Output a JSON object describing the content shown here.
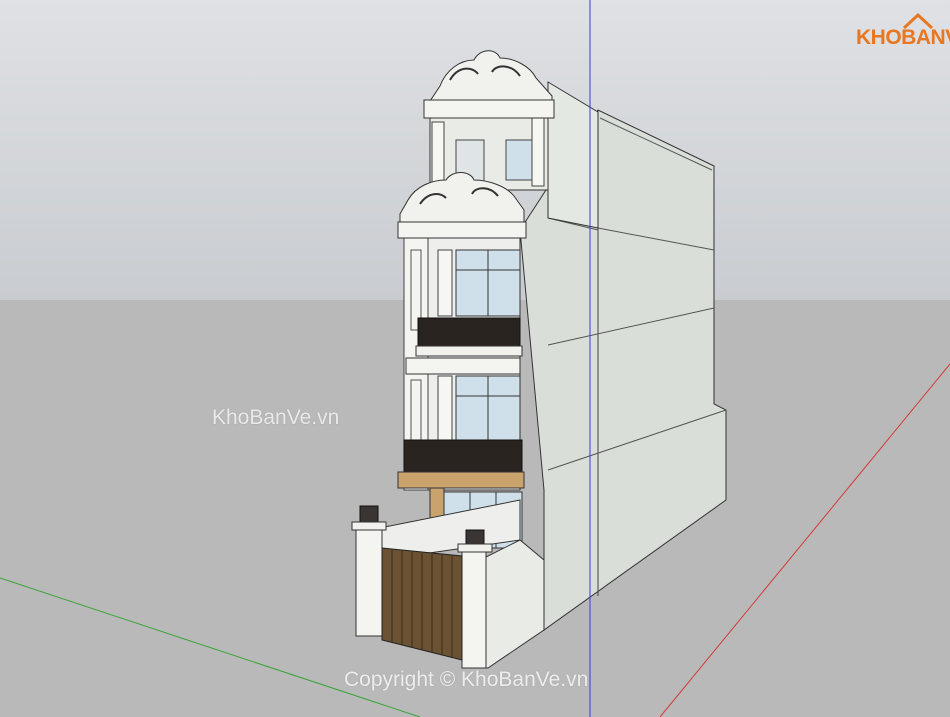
{
  "logo": {
    "text": "KHOBANVE",
    "icon": "house-roof-icon",
    "color": "#e87722"
  },
  "watermarks": {
    "left": "KhoBanVe.vn",
    "bottom": "Copyright © KhoBanVe.vn"
  },
  "colors": {
    "sky": "#d6d8db",
    "ground": "#b9b9b9",
    "wall": "#dde2dc",
    "trim": "#f1f1ee",
    "iron": "#2a2420",
    "glass": "#cfe0ea",
    "gate": "#6a5233",
    "wood": "#c9a36e",
    "axis_red": "#d23a3a",
    "axis_green": "#3aa33a",
    "axis_blue": "#3b3bd6"
  }
}
